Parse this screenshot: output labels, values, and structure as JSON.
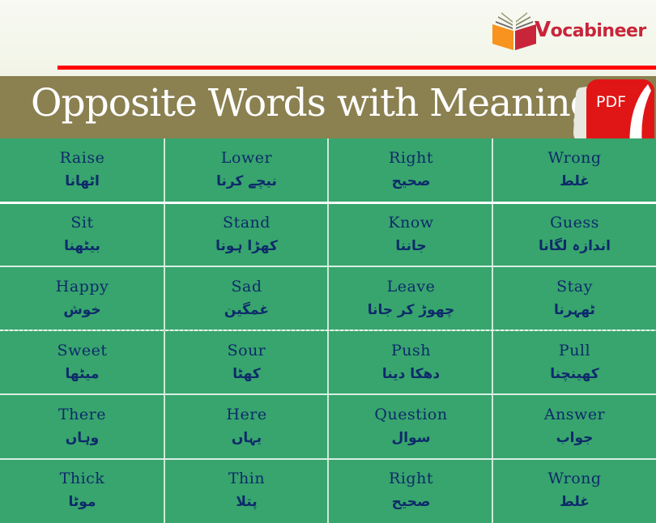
{
  "brand": {
    "logo_letter": "V",
    "logo_rest": "ocabineer",
    "colors": {
      "red": "#ff0000",
      "logo_orange": "#f7931e",
      "logo_red": "#c8253a"
    }
  },
  "banner": {
    "title": "Opposite Words with Meaning",
    "pdf_label": "PDF",
    "background": "#8a8050"
  },
  "table": {
    "background": "#37a56d",
    "text_color": "#0e2a6b",
    "rows": [
      [
        {
          "en": "Raise",
          "ur": "اٹھانا"
        },
        {
          "en": "Lower",
          "ur": "نیچے کرنا"
        },
        {
          "en": "Right",
          "ur": "صحیح"
        },
        {
          "en": "Wrong",
          "ur": "غلط"
        }
      ],
      [
        {
          "en": "Sit",
          "ur": "بیٹھنا"
        },
        {
          "en": "Stand",
          "ur": "کھڑا ہونا"
        },
        {
          "en": "Know",
          "ur": "جاننا"
        },
        {
          "en": "Guess",
          "ur": "اندازہ لگانا"
        }
      ],
      [
        {
          "en": "Happy",
          "ur": "خوش"
        },
        {
          "en": "Sad",
          "ur": "غمگین"
        },
        {
          "en": "Leave",
          "ur": "چھوڑ کر جانا"
        },
        {
          "en": "Stay",
          "ur": "ٹھہرنا"
        }
      ],
      [
        {
          "en": "Sweet",
          "ur": "میٹھا"
        },
        {
          "en": "Sour",
          "ur": "کھٹا"
        },
        {
          "en": "Push",
          "ur": "دھکا دینا"
        },
        {
          "en": "Pull",
          "ur": "کھینچنا"
        }
      ],
      [
        {
          "en": "There",
          "ur": "وہاں"
        },
        {
          "en": "Here",
          "ur": "یہاں"
        },
        {
          "en": "Question",
          "ur": "سوال"
        },
        {
          "en": "Answer",
          "ur": "جواب"
        }
      ],
      [
        {
          "en": "Thick",
          "ur": "موٹا"
        },
        {
          "en": "Thin",
          "ur": "پتلا"
        },
        {
          "en": "Right",
          "ur": "صحیح"
        },
        {
          "en": "Wrong",
          "ur": "غلط"
        }
      ]
    ]
  }
}
